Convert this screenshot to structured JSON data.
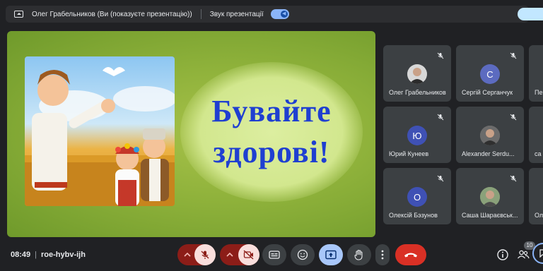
{
  "topbar": {
    "presenter_text": "Олег Грабельников (Ви (показуєте презентацію))",
    "sound_label": "Звук презентації"
  },
  "slide": {
    "line1": "Бувайте",
    "line2": "здорові!"
  },
  "participants": [
    {
      "name": "Олег Грабельников",
      "avatar_type": "photo"
    },
    {
      "name": "Сергій Серганчук",
      "initial": "С",
      "color": "#5c6bc0"
    },
    {
      "name": "Пе",
      "initial": "",
      "color": "#3c4043"
    },
    {
      "name": "Юрий Кунеев",
      "initial": "Ю",
      "color": "#3f51b5"
    },
    {
      "name": "Alexander Serdu...",
      "avatar_type": "photo"
    },
    {
      "name": "са",
      "initial": "",
      "color": "#3c4043"
    },
    {
      "name": "Олексій Бэзунов",
      "initial": "О",
      "color": "#3f51b5"
    },
    {
      "name": "Саша Шараєвськ...",
      "avatar_type": "photo"
    },
    {
      "name": "Ол",
      "initial": "",
      "color": "#3c4043"
    }
  ],
  "bottom": {
    "time": "08:49",
    "separator": "|",
    "meeting_code": "roe-hybv-ijh",
    "participant_count": "10"
  },
  "icons": {
    "mic": "mic-off-icon",
    "camera": "camera-off-icon",
    "captions": "captions-icon",
    "emoji": "emoji-icon",
    "present": "present-screen-icon",
    "hand": "raise-hand-icon",
    "more": "more-vert-icon",
    "end": "end-call-icon",
    "info": "info-icon",
    "people": "people-icon",
    "chat": "chat-icon"
  },
  "colors": {
    "end_call": "#d93025",
    "muted_dark": "#8c1d18",
    "muted_light": "#f9dedc",
    "present_active": "#a8c7fa",
    "accent": "#8ab4f8"
  }
}
